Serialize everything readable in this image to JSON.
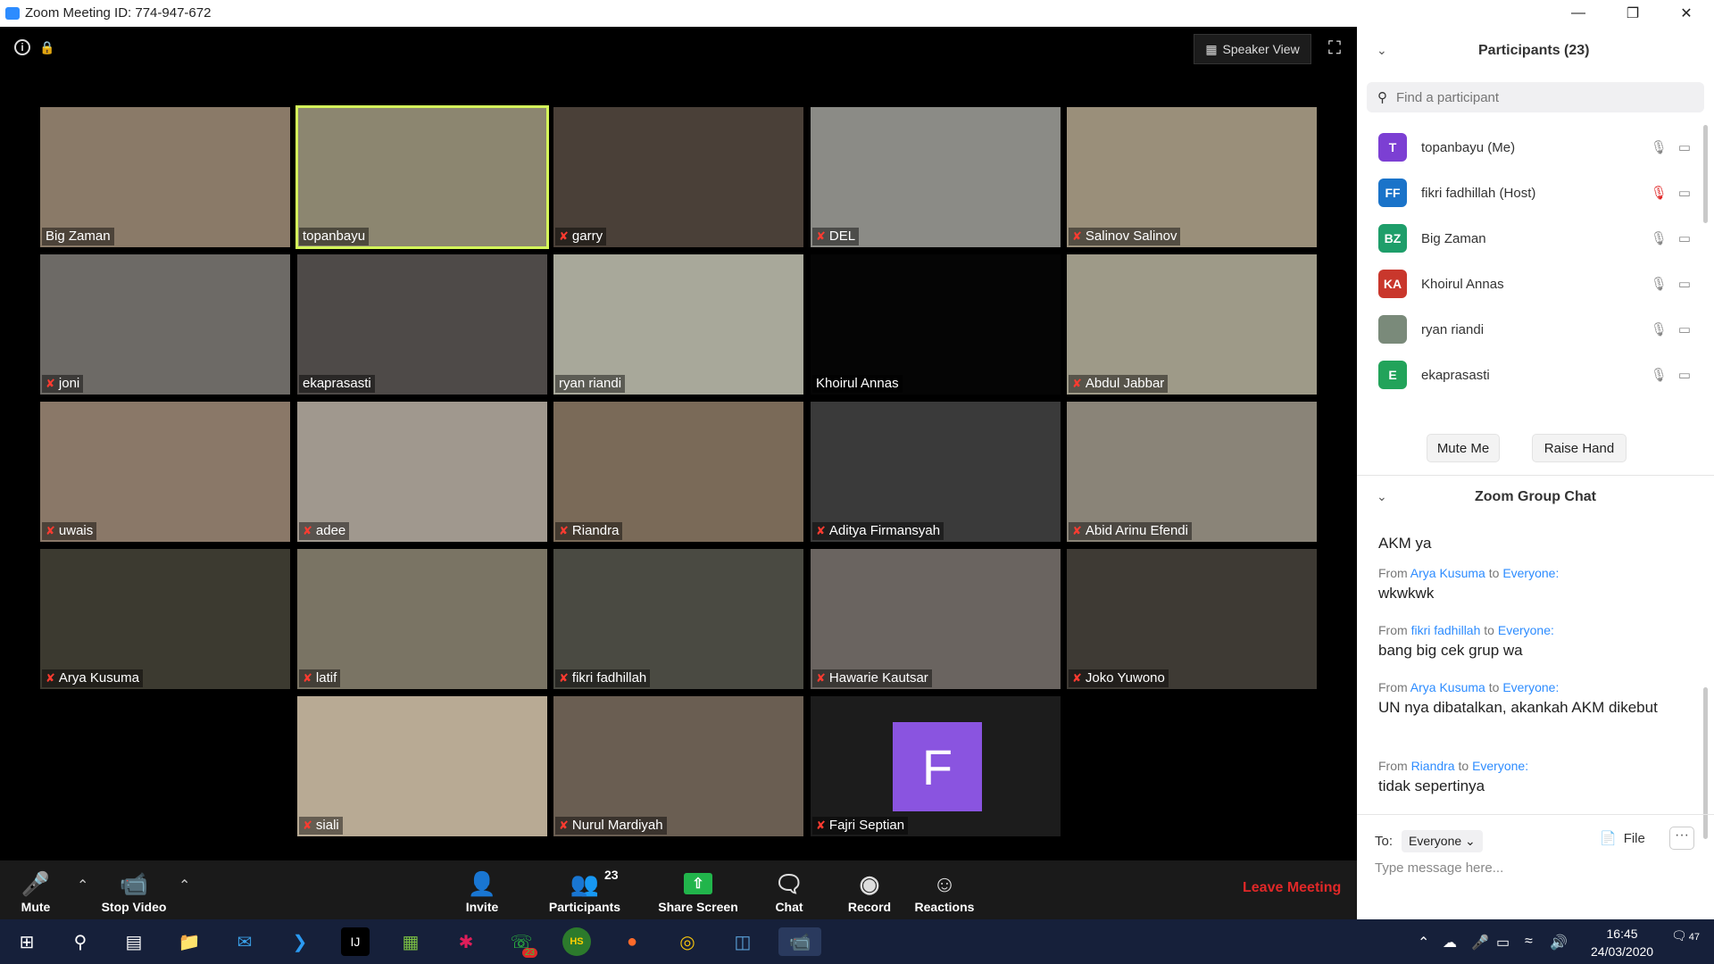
{
  "window": {
    "title": "Zoom Meeting ID: 774-947-672",
    "minimize": "—",
    "restore": "❐",
    "close": "✕"
  },
  "stage": {
    "speaker_view_label": "Speaker View",
    "info_glyph": "i"
  },
  "tiles": [
    {
      "name": "Big Zaman",
      "muted": false,
      "color": "#8a7a68"
    },
    {
      "name": "topanbayu",
      "muted": false,
      "active": true,
      "color": "#8c8670"
    },
    {
      "name": "garry",
      "muted": true,
      "color": "#4a4038"
    },
    {
      "name": "DEL",
      "muted": true,
      "color": "#8b8b86"
    },
    {
      "name": "Salinov Salinov",
      "muted": true,
      "color": "#9a8f7a"
    },
    {
      "name": "joni",
      "muted": true,
      "color": "#6d6a66"
    },
    {
      "name": "ekaprasasti",
      "muted": false,
      "color": "#4e4a48"
    },
    {
      "name": "ryan riandi",
      "muted": false,
      "color": "#a8a89a"
    },
    {
      "name": "Khoirul Annas",
      "muted": false,
      "color": "#050505"
    },
    {
      "name": "Abdul Jabbar",
      "muted": true,
      "color": "#9e9a88"
    },
    {
      "name": "uwais",
      "muted": true,
      "color": "#8a7868"
    },
    {
      "name": "adee",
      "muted": true,
      "color": "#a0988e"
    },
    {
      "name": "Riandra",
      "muted": true,
      "color": "#7a6a58"
    },
    {
      "name": "Aditya Firmansyah",
      "muted": true,
      "color": "#3a3a3a"
    },
    {
      "name": "Abid Arinu Efendi",
      "muted": true,
      "color": "#8a8478"
    },
    {
      "name": "Arya Kusuma",
      "muted": true,
      "color": "#3c3a30"
    },
    {
      "name": "latif",
      "muted": true,
      "color": "#7a7464"
    },
    {
      "name": "fikri fadhillah",
      "muted": true,
      "color": "#4a4a42"
    },
    {
      "name": "Hawarie Kautsar",
      "muted": true,
      "color": "#6a6460"
    },
    {
      "name": "Joko Yuwono",
      "muted": true,
      "color": "#3e3a34"
    },
    {
      "name": "siali",
      "muted": true,
      "color": "#b8aa94"
    },
    {
      "name": "Nurul Mardiyah",
      "muted": true,
      "color": "#6a5e52"
    },
    {
      "name": "Fajri Septian",
      "muted": true,
      "color": "#1c1c1c",
      "avatar_letter": "F"
    }
  ],
  "toolbar": {
    "mute": "Mute",
    "stop_video": "Stop Video",
    "invite": "Invite",
    "participants": "Participants",
    "participants_count": "23",
    "share_screen": "Share Screen",
    "chat": "Chat",
    "record": "Record",
    "reactions": "Reactions",
    "leave": "Leave Meeting"
  },
  "participants_panel": {
    "title": "Participants (23)",
    "search_placeholder": "Find a participant",
    "list": [
      {
        "initials": "T",
        "name": "topanbayu (Me)",
        "color": "#7c3fd3",
        "mic_muted": false
      },
      {
        "initials": "FF",
        "name": "fikri fadhillah (Host)",
        "color": "#1a73c9",
        "mic_muted": true
      },
      {
        "initials": "BZ",
        "name": "Big Zaman",
        "color": "#1e9e6a",
        "mic_muted": false
      },
      {
        "initials": "KA",
        "name": "Khoirul Annas",
        "color": "#c9372c",
        "mic_muted": false
      },
      {
        "initials": "",
        "name": "ryan riandi",
        "color": "#7a8a7a",
        "mic_muted": false
      },
      {
        "initials": "E",
        "name": "ekaprasasti",
        "color": "#22a35a",
        "mic_muted": false
      }
    ],
    "mute_me": "Mute Me",
    "raise_hand": "Raise Hand"
  },
  "chat_panel": {
    "title": "Zoom Group Chat",
    "partial_text": "AKM ya",
    "messages": [
      {
        "from_label": "From",
        "sender": "Arya Kusuma",
        "to_label": "to",
        "recipient": "Everyone:",
        "text": "wkwkwk"
      },
      {
        "from_label": "From",
        "sender": "fikri fadhillah",
        "to_label": "to",
        "recipient": "Everyone:",
        "text": "bang big cek grup wa"
      },
      {
        "from_label": "From",
        "sender": "Arya Kusuma",
        "to_label": "to",
        "recipient": "Everyone:",
        "text": "UN nya dibatalkan, akankah AKM dikebut"
      },
      {
        "from_label": "From",
        "sender": "Riandra",
        "to_label": "to",
        "recipient": "Everyone:",
        "text": "tidak sepertinya"
      }
    ],
    "to_label": "To:",
    "to_value": "Everyone",
    "file_label": "File",
    "more_label": "···",
    "input_placeholder": "Type message here..."
  },
  "taskbar": {
    "time": "16:45",
    "date": "24/03/2020",
    "notification_count": "47",
    "app_badge": "23"
  },
  "colors": {
    "active_speaker": "#d4f55a",
    "leave": "#e02828",
    "link": "#2d8cff",
    "share_green": "#21b54b"
  }
}
